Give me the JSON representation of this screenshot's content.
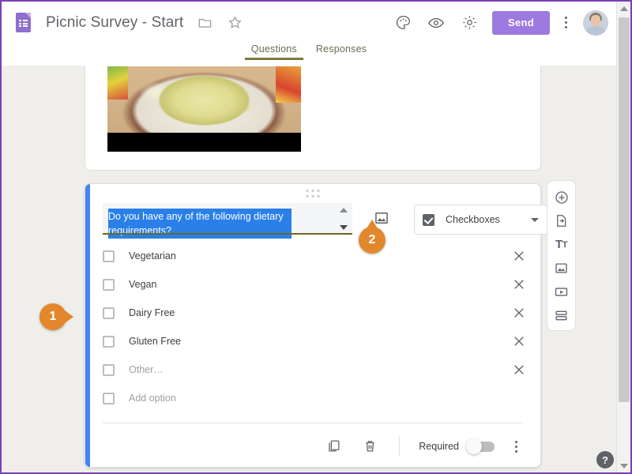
{
  "window": {
    "title": "Picnic Survey - Start"
  },
  "header": {
    "logo_icon": "forms-document-icon",
    "doc_title": "Picnic Survey - Start",
    "move_folder_icon": "folder-icon",
    "star_icon": "star-icon",
    "theme_icon": "palette-icon",
    "preview_icon": "eye-icon",
    "settings_icon": "gear-icon",
    "send_label": "Send",
    "more_icon": "kebab-menu-icon",
    "avatar_icon": "user-avatar"
  },
  "tabs": [
    {
      "label": "Questions",
      "active": true
    },
    {
      "label": "Responses",
      "active": false
    }
  ],
  "image_card": {
    "photo_alt": "potato-salad-photo"
  },
  "question": {
    "drag_handle_icon": "drag-handle-icon",
    "title_text": "Do you have any of the following dietary requirements?",
    "title_selected": true,
    "insert_image_icon": "insert-image-icon",
    "type_icon": "checkbox-icon",
    "type_label": "Checkboxes",
    "type_caret_icon": "chevron-down-icon",
    "options": [
      {
        "label": "Vegetarian",
        "muted": false,
        "removable": true
      },
      {
        "label": "Vegan",
        "muted": false,
        "removable": true
      },
      {
        "label": "Dairy Free",
        "muted": false,
        "removable": true
      },
      {
        "label": "Gluten Free",
        "muted": false,
        "removable": true
      },
      {
        "label": "Other…",
        "muted": true,
        "removable": true
      },
      {
        "label": "Add option",
        "muted": true,
        "removable": false
      }
    ],
    "footer": {
      "duplicate_icon": "duplicate-icon",
      "delete_icon": "trash-icon",
      "required_label": "Required",
      "required_on": false,
      "more_icon": "kebab-menu-icon"
    }
  },
  "side_toolbar": {
    "items": [
      {
        "icon": "add-question-icon"
      },
      {
        "icon": "import-questions-icon"
      },
      {
        "icon": "add-title-icon",
        "glyph_main": "T",
        "glyph_sub": "T"
      },
      {
        "icon": "add-image-icon"
      },
      {
        "icon": "add-video-icon"
      },
      {
        "icon": "add-section-icon"
      }
    ]
  },
  "callouts": [
    {
      "number": "1",
      "points": "right"
    },
    {
      "number": "2",
      "points": "up"
    }
  ],
  "help": {
    "label": "?"
  },
  "scrollbar": {
    "up_icon": "scroll-up-arrow",
    "down_icon": "scroll-down-arrow"
  },
  "colors": {
    "brand_purple": "#9c7ae0",
    "accent_blue": "#4285f4",
    "callout_orange": "#e3872c",
    "tab_underline": "#7c7a3d",
    "selection_blue": "#2a7fe8",
    "page_bg": "#efeeea"
  }
}
